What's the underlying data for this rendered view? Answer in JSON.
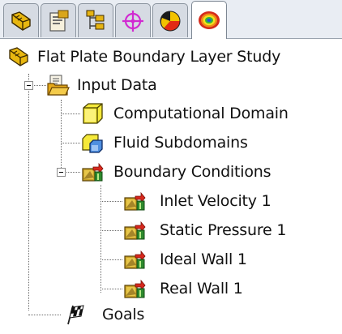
{
  "tabs": [
    {
      "icon": "feature-manager-icon",
      "active": false
    },
    {
      "icon": "property-manager-icon",
      "active": false
    },
    {
      "icon": "configuration-manager-icon",
      "active": false
    },
    {
      "icon": "dimxpert-manager-icon",
      "active": false
    },
    {
      "icon": "display-manager-icon",
      "active": false
    },
    {
      "icon": "flow-simulation-analysis-tree-icon",
      "active": true
    }
  ],
  "tree": {
    "root": {
      "label": "Flat Plate Boundary Layer Study",
      "icon": "study-icon"
    },
    "input_data": {
      "label": "Input Data",
      "icon": "input-data-folder-icon",
      "expanded": true
    },
    "computational_domain": {
      "label": "Computational Domain",
      "icon": "computational-domain-icon"
    },
    "fluid_subdomains": {
      "label": "Fluid Subdomains",
      "icon": "fluid-subdomains-icon"
    },
    "boundary_conditions": {
      "label": "Boundary Conditions",
      "icon": "boundary-conditions-icon",
      "expanded": true
    },
    "inlet_velocity": {
      "label": "Inlet Velocity 1",
      "icon": "boundary-condition-icon"
    },
    "static_pressure": {
      "label": "Static Pressure 1",
      "icon": "boundary-condition-icon"
    },
    "ideal_wall": {
      "label": "Ideal Wall 1",
      "icon": "boundary-condition-icon"
    },
    "real_wall": {
      "label": "Real Wall 1",
      "icon": "boundary-condition-icon"
    },
    "goals": {
      "label": "Goals",
      "icon": "checkered-flag-icon"
    }
  }
}
